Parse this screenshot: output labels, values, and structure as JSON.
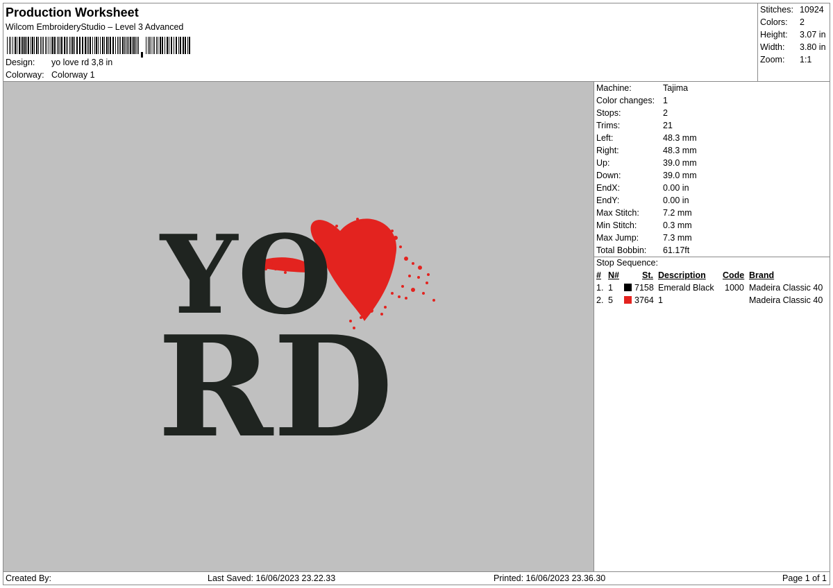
{
  "header": {
    "title": "Production Worksheet",
    "subtitle": "Wilcom EmbroideryStudio – Level 3 Advanced",
    "design_label": "Design:",
    "design_value": "yo love rd 3,8 in",
    "colorway_label": "Colorway:",
    "colorway_value": "Colorway 1"
  },
  "summary": [
    {
      "label": "Stitches:",
      "value": "10924"
    },
    {
      "label": "Colors:",
      "value": "2"
    },
    {
      "label": "Height:",
      "value": "3.07 in"
    },
    {
      "label": "Width:",
      "value": "3.80 in"
    },
    {
      "label": "Zoom:",
      "value": "1:1"
    }
  ],
  "design_preview": {
    "line1": "YO",
    "line2": "RD",
    "thread_color": "#1f2420",
    "heart_color": "#e3231f",
    "background": "#c0c0c0"
  },
  "stats": [
    {
      "label": "Machine:",
      "value": "Tajima"
    },
    {
      "label": "Color changes:",
      "value": "1"
    },
    {
      "label": "Stops:",
      "value": "2"
    },
    {
      "label": "Trims:",
      "value": "21"
    },
    {
      "label": "Left:",
      "value": "48.3 mm"
    },
    {
      "label": "Right:",
      "value": "48.3 mm"
    },
    {
      "label": "Up:",
      "value": "39.0 mm"
    },
    {
      "label": "Down:",
      "value": "39.0 mm"
    },
    {
      "label": "EndX:",
      "value": "0.00 in"
    },
    {
      "label": "EndY:",
      "value": "0.00 in"
    },
    {
      "label": "Max Stitch:",
      "value": "7.2 mm"
    },
    {
      "label": "Min Stitch:",
      "value": "0.3 mm"
    },
    {
      "label": "Max Jump:",
      "value": "7.3 mm"
    },
    {
      "label": "Total Bobbin:",
      "value": "61.17ft"
    }
  ],
  "stop_sequence": {
    "title": "Stop Sequence:",
    "headers": {
      "num": "#",
      "n": "N#",
      "st": "St.",
      "description": "Description",
      "code": "Code",
      "brand": "Brand"
    },
    "rows": [
      {
        "num": "1.",
        "n": "1",
        "color": "#000000",
        "st": "7158",
        "description": "Emerald Black",
        "code": "1000",
        "brand": "Madeira Classic 40"
      },
      {
        "num": "2.",
        "n": "5",
        "color": "#e3231f",
        "st": "3764",
        "description": "1",
        "code": "",
        "brand": "Madeira Classic 40"
      }
    ]
  },
  "footer": {
    "created_by": "Created By:",
    "last_saved": "Last Saved: 16/06/2023 23.22.33",
    "printed": "Printed: 16/06/2023 23.36.30",
    "page": "Page 1 of 1"
  }
}
